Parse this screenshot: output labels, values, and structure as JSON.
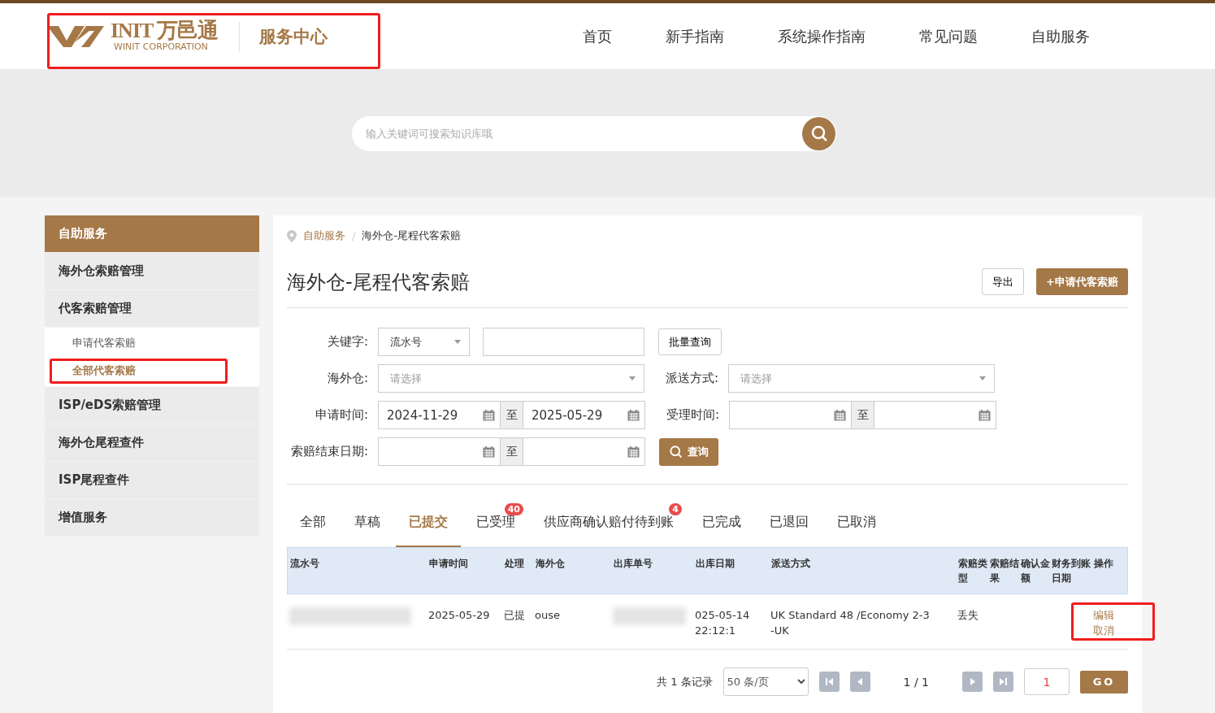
{
  "header": {
    "logo_mark": "INIT",
    "logo_cn": "万邑通",
    "logo_en": "WINIT CORPORATION",
    "site_title": "服务中心",
    "nav": [
      {
        "label": "首页"
      },
      {
        "label": "新手指南"
      },
      {
        "label": "系统操作指南"
      },
      {
        "label": "常见问题"
      },
      {
        "label": "自助服务"
      }
    ]
  },
  "search": {
    "placeholder": "输入关键词可搜索知识库哦"
  },
  "sidebar": {
    "title": "自助服务",
    "items": [
      {
        "label": "海外仓索赔管理"
      },
      {
        "label": "代客索赔管理",
        "expanded": true,
        "children": [
          {
            "label": "申请代客索赔",
            "selected": false
          },
          {
            "label": "全部代客索赔",
            "selected": true
          }
        ]
      },
      {
        "label": "ISP/eDS索赔管理"
      },
      {
        "label": "海外仓尾程查件"
      },
      {
        "label": "ISP尾程查件"
      },
      {
        "label": "增值服务"
      }
    ]
  },
  "breadcrumb": [
    {
      "label": "自助服务"
    },
    {
      "label": "海外仓-尾程代客索赔"
    }
  ],
  "breadcrumb_separator": "/",
  "page_title": "海外仓-尾程代客索赔",
  "actions": {
    "export": "导出",
    "apply": "+申请代客索赔"
  },
  "filters": {
    "keyword_label": "关键字:",
    "keyword_type": "流水号",
    "batch_button": "批量查询",
    "warehouse_label": "海外仓:",
    "warehouse_placeholder": "请选择",
    "delivery_label": "派送方式:",
    "delivery_placeholder": "请选择",
    "apply_time_label": "申请时间:",
    "apply_from": "2024-11-29",
    "to_1": "至",
    "apply_to": "2025-05-29",
    "accept_time_label": "受理时间:",
    "to_2": "至",
    "end_date_label": "索赔结束日期:",
    "to_3": "至",
    "query_button": "查询"
  },
  "tabs": [
    {
      "label": "全部",
      "selected": false
    },
    {
      "label": "草稿",
      "selected": false
    },
    {
      "label": "已提交",
      "selected": true
    },
    {
      "label": "已受理",
      "selected": false,
      "badge": "40"
    },
    {
      "label": "供应商确认赔付待到账",
      "selected": false,
      "badge": "4"
    },
    {
      "label": "已完成",
      "selected": false
    },
    {
      "label": "已退回",
      "selected": false
    },
    {
      "label": "已取消",
      "selected": false
    }
  ],
  "table": {
    "columns": [
      "流水号",
      "申请时间",
      "处理",
      "海外仓",
      "出库单号",
      "出库日期",
      "派送方式",
      "索赔类型",
      "索赔结果",
      "确认金额",
      "财务到账日期",
      "操作"
    ],
    "rows": [
      {
        "cells": [
          [],
          [
            "2025-05-29"
          ],
          [
            "已提"
          ],
          [
            "ouse"
          ],
          [],
          [
            "025-05-14",
            "22:12:1"
          ],
          [
            "UK Standard 48 /Economy 2-3",
            "-UK"
          ],
          [
            "丢失"
          ],
          [],
          [],
          []
        ],
        "actions": [
          "编辑",
          "取消"
        ]
      }
    ]
  },
  "pagination": {
    "total": "共 1 条记录",
    "page_size": "50 条/页",
    "page": "1 / 1",
    "page_input": "1",
    "go": "GO"
  }
}
